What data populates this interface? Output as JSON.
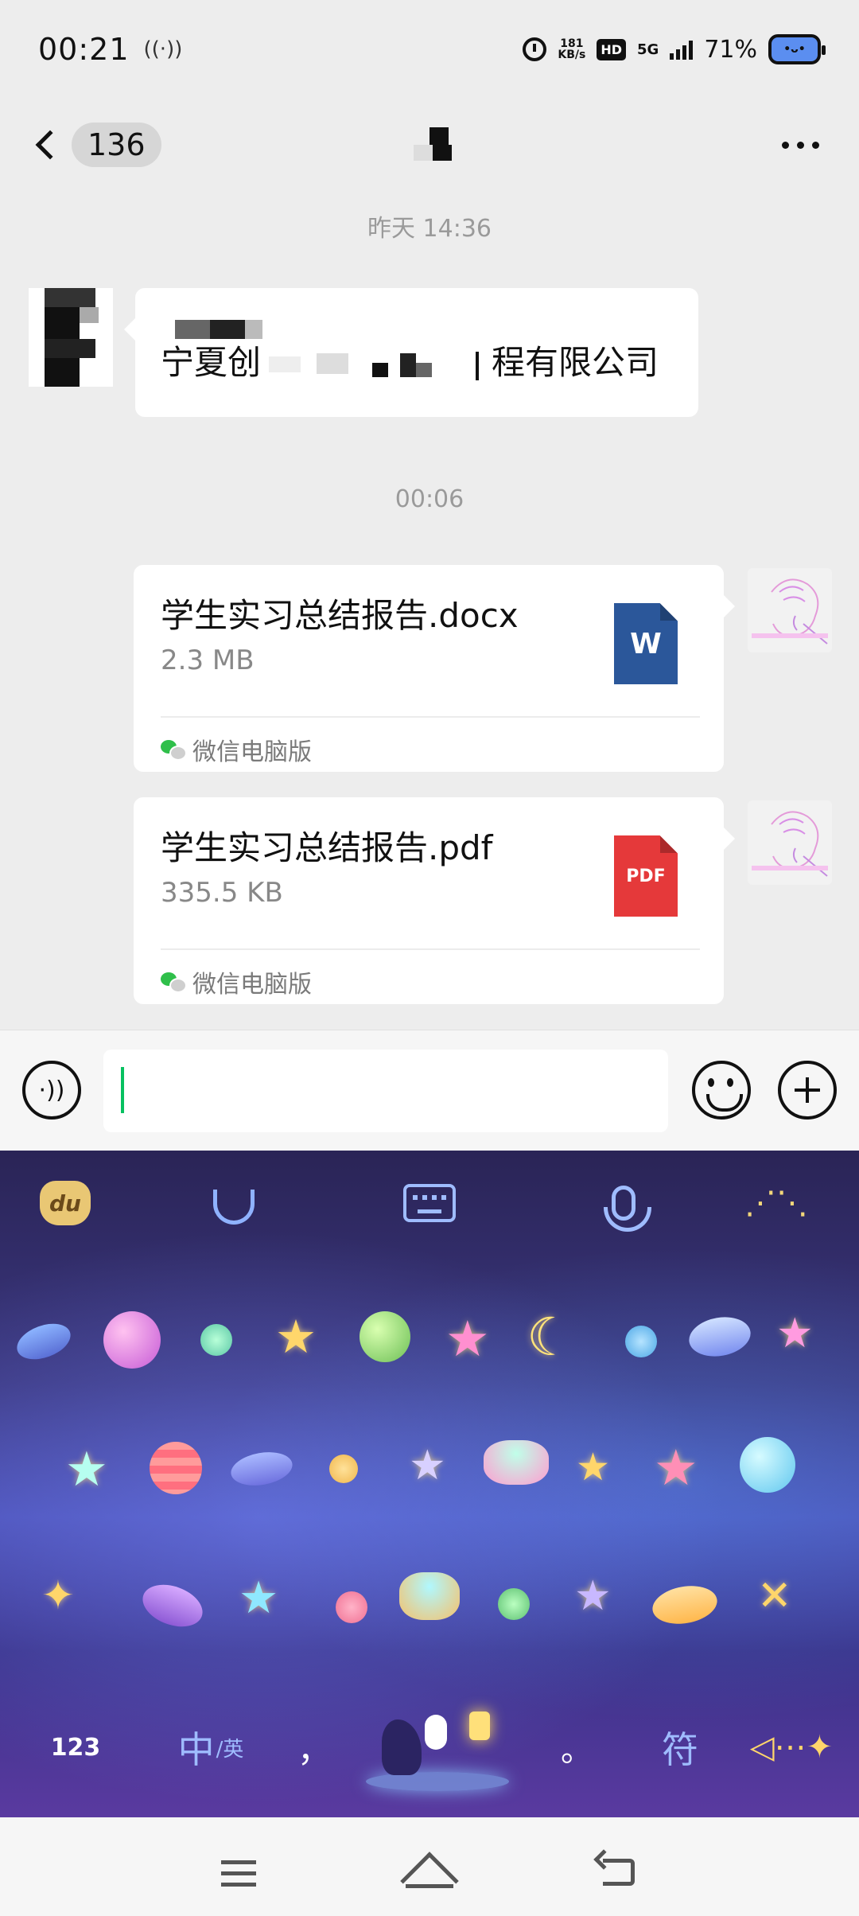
{
  "status_bar": {
    "time": "00:21",
    "net_speed_value": "181",
    "net_speed_unit": "KB/s",
    "hd_label": "HD",
    "network_type": "5G",
    "battery_percent": "71%"
  },
  "title_bar": {
    "unread_count": "136",
    "back_icon": "chevron-left-icon",
    "more_icon": "more-dots-icon"
  },
  "messages": {
    "timestamp_1": "昨天 14:36",
    "received_text_start": "宁夏创",
    "received_text_end": "程有限公司",
    "timestamp_2": "00:06"
  },
  "files": [
    {
      "name": "学生实习总结报告.docx",
      "size": "2.3 MB",
      "source": "微信电脑版",
      "icon": "word-doc-icon",
      "icon_label": "W",
      "icon_color": "#2b579a"
    },
    {
      "name": "学生实习总结报告.pdf",
      "size": "335.5 KB",
      "source": "微信电脑版",
      "icon": "pdf-doc-icon",
      "icon_label": "PDF",
      "icon_color": "#e5393a"
    }
  ],
  "input_bar": {
    "value": "",
    "accent_color": "#07c160"
  },
  "keyboard": {
    "logo_text": "du",
    "key_123": "123",
    "key_lang_main": "中",
    "key_lang_sub": "/英",
    "key_comma": "，",
    "key_period": "。",
    "key_symbol": "符"
  },
  "nav_bar": {
    "menu_icon": "menu-icon",
    "home_icon": "home-icon",
    "back_icon": "back-icon"
  }
}
